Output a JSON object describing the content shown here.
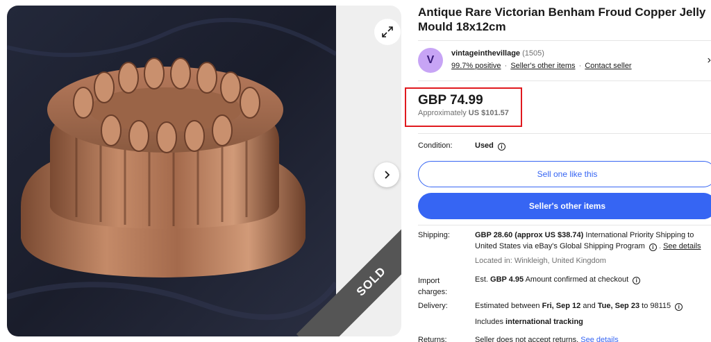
{
  "gallery": {
    "expand_icon": "expand-icon",
    "next_icon": "chevron-right-icon",
    "sold_label": "SOLD"
  },
  "listing": {
    "title": "Antique Rare Victorian Benham Froud Copper Jelly Mould 18x12cm"
  },
  "seller": {
    "initial": "V",
    "name": "vintageinthevillage",
    "count": "(1505)",
    "positive": "99.7% positive",
    "other_items": "Seller's other items",
    "contact": "Contact seller",
    "sep": "·",
    "chevron": "›"
  },
  "price": {
    "main": "GBP 74.99",
    "approx_prefix": "Approximately",
    "approx_value": "US $101.57",
    "highlight_color": "#e0191e"
  },
  "condition": {
    "label": "Condition:",
    "value": "Used",
    "info": "i"
  },
  "buttons": {
    "sell_one": "Sell one like this",
    "sellers_other": "Seller's other items",
    "accent_color": "#3665f3"
  },
  "shipping": {
    "label": "Shipping:",
    "amount": "GBP 28.60 (approx US $38.74)",
    "text1": "International Priority Shipping to",
    "text2": "United States via eBay's Global Shipping Program",
    "see_details": "See details",
    "located": "Located in: Winkleigh, United Kingdom"
  },
  "import": {
    "label_line1": "Import",
    "label_line2": "charges:",
    "prefix": "Est.",
    "amount": "GBP 4.95",
    "suffix": "Amount confirmed at checkout"
  },
  "delivery": {
    "label": "Delivery:",
    "prefix": "Estimated between",
    "start": "Fri, Sep 12",
    "and": "and",
    "end": "Tue, Sep 23",
    "to": "to 98115",
    "includes": "Includes",
    "tracking": "international tracking"
  },
  "returns": {
    "label": "Returns:",
    "text": "Seller does not accept returns.",
    "see_details": "See details"
  }
}
